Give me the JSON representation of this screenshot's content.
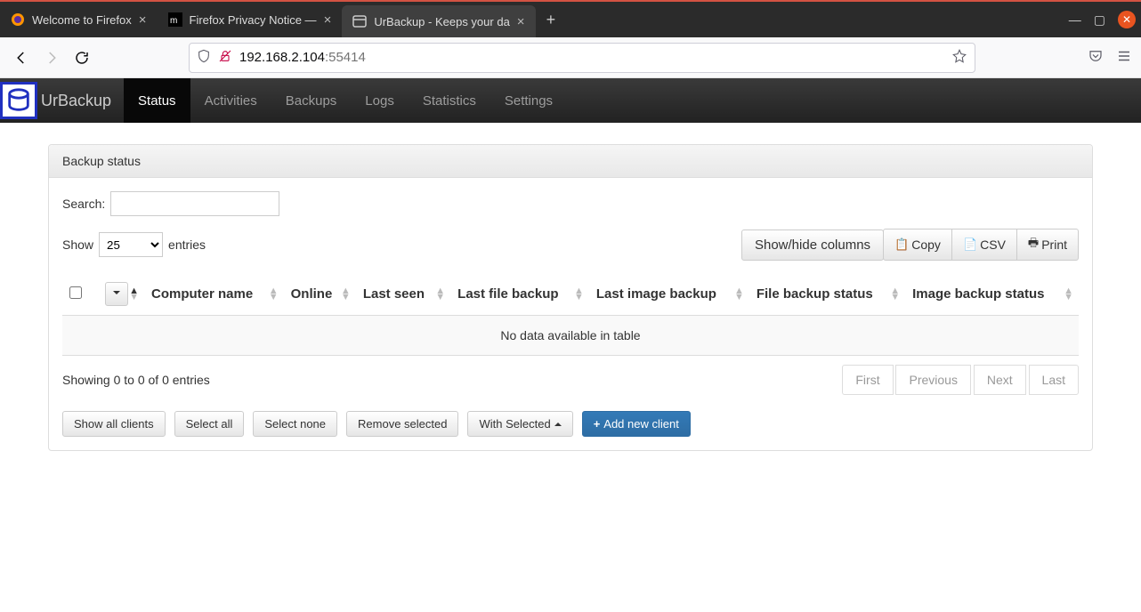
{
  "browser": {
    "tabs": [
      {
        "title": "Welcome to Firefox"
      },
      {
        "title": "Firefox Privacy Notice —"
      },
      {
        "title": "UrBackup - Keeps your da"
      }
    ],
    "url_host": "192.168.2.104",
    "url_port": ":55414"
  },
  "app": {
    "brand": "UrBackup",
    "nav": [
      "Status",
      "Activities",
      "Backups",
      "Logs",
      "Statistics",
      "Settings"
    ],
    "active_nav": "Status"
  },
  "panel": {
    "heading": "Backup status",
    "search_label": "Search:",
    "show_label_pre": "Show",
    "show_label_post": "entries",
    "length_value": "25",
    "showhide": "Show/hide columns",
    "export": {
      "copy": "Copy",
      "csv": "CSV",
      "print": "Print"
    },
    "columns": [
      "Computer name",
      "Online",
      "Last seen",
      "Last file backup",
      "Last image backup",
      "File backup status",
      "Image backup status"
    ],
    "empty": "No data available in table",
    "info": "Showing 0 to 0 of 0 entries",
    "paginate": {
      "first": "First",
      "prev": "Previous",
      "next": "Next",
      "last": "Last"
    },
    "actions": {
      "show_all": "Show all clients",
      "select_all": "Select all",
      "select_none": "Select none",
      "remove_selected": "Remove selected",
      "with_selected": "With Selected",
      "add_new": "Add new client"
    }
  }
}
